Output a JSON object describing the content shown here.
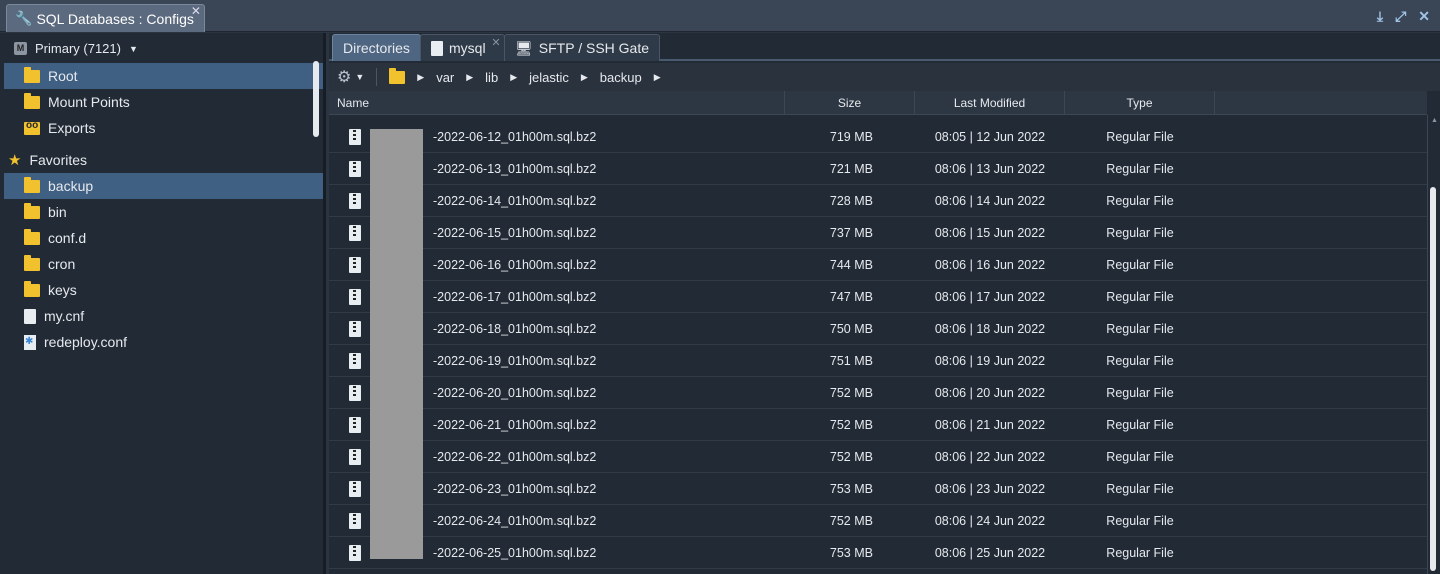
{
  "window": {
    "title": "SQL Databases : Configs",
    "close": "✕",
    "icons": [
      "download-icon",
      "expand-icon",
      "close-icon"
    ]
  },
  "sidebar": {
    "env_badge": "M",
    "env_label": "Primary (7121)",
    "items": [
      {
        "label": "Root",
        "icon": "folder-icon",
        "selected": true
      },
      {
        "label": "Mount Points",
        "icon": "folder-icon"
      },
      {
        "label": "Exports",
        "icon": "exports-icon"
      }
    ],
    "favorites_label": "Favorites",
    "favorites": [
      {
        "label": "backup",
        "icon": "folder-icon",
        "selected": true
      },
      {
        "label": "bin",
        "icon": "folder-icon"
      },
      {
        "label": "conf.d",
        "icon": "folder-icon"
      },
      {
        "label": "cron",
        "icon": "folder-icon"
      },
      {
        "label": "keys",
        "icon": "folder-icon"
      },
      {
        "label": "my.cnf",
        "icon": "file-icon"
      },
      {
        "label": "redeploy.conf",
        "icon": "config-file-icon"
      }
    ]
  },
  "tabs": [
    {
      "label": "Directories",
      "active": true
    },
    {
      "label": "mysql",
      "closable": true
    },
    {
      "label": "SFTP / SSH Gate"
    }
  ],
  "breadcrumb": [
    "var",
    "lib",
    "jelastic",
    "backup"
  ],
  "columns": {
    "name": "Name",
    "size": "Size",
    "modified": "Last Modified",
    "type": "Type"
  },
  "files": [
    {
      "name": "-2022-06-12_01h00m.sql.bz2",
      "size": "719 MB",
      "modified": "08:05 | 12 Jun 2022",
      "type": "Regular File"
    },
    {
      "name": "-2022-06-13_01h00m.sql.bz2",
      "size": "721 MB",
      "modified": "08:06 | 13 Jun 2022",
      "type": "Regular File"
    },
    {
      "name": "-2022-06-14_01h00m.sql.bz2",
      "size": "728 MB",
      "modified": "08:06 | 14 Jun 2022",
      "type": "Regular File"
    },
    {
      "name": "-2022-06-15_01h00m.sql.bz2",
      "size": "737 MB",
      "modified": "08:06 | 15 Jun 2022",
      "type": "Regular File"
    },
    {
      "name": "-2022-06-16_01h00m.sql.bz2",
      "size": "744 MB",
      "modified": "08:06 | 16 Jun 2022",
      "type": "Regular File"
    },
    {
      "name": "-2022-06-17_01h00m.sql.bz2",
      "size": "747 MB",
      "modified": "08:06 | 17 Jun 2022",
      "type": "Regular File"
    },
    {
      "name": "-2022-06-18_01h00m.sql.bz2",
      "size": "750 MB",
      "modified": "08:06 | 18 Jun 2022",
      "type": "Regular File"
    },
    {
      "name": "-2022-06-19_01h00m.sql.bz2",
      "size": "751 MB",
      "modified": "08:06 | 19 Jun 2022",
      "type": "Regular File"
    },
    {
      "name": "-2022-06-20_01h00m.sql.bz2",
      "size": "752 MB",
      "modified": "08:06 | 20 Jun 2022",
      "type": "Regular File"
    },
    {
      "name": "-2022-06-21_01h00m.sql.bz2",
      "size": "752 MB",
      "modified": "08:06 | 21 Jun 2022",
      "type": "Regular File"
    },
    {
      "name": "-2022-06-22_01h00m.sql.bz2",
      "size": "752 MB",
      "modified": "08:06 | 22 Jun 2022",
      "type": "Regular File"
    },
    {
      "name": "-2022-06-23_01h00m.sql.bz2",
      "size": "753 MB",
      "modified": "08:06 | 23 Jun 2022",
      "type": "Regular File"
    },
    {
      "name": "-2022-06-24_01h00m.sql.bz2",
      "size": "752 MB",
      "modified": "08:06 | 24 Jun 2022",
      "type": "Regular File"
    },
    {
      "name": "-2022-06-25_01h00m.sql.bz2",
      "size": "753 MB",
      "modified": "08:06 | 25 Jun 2022",
      "type": "Regular File"
    }
  ],
  "colors": {
    "accent": "#3f5f83",
    "folder": "#f2c12e",
    "panel": "#222a35"
  }
}
